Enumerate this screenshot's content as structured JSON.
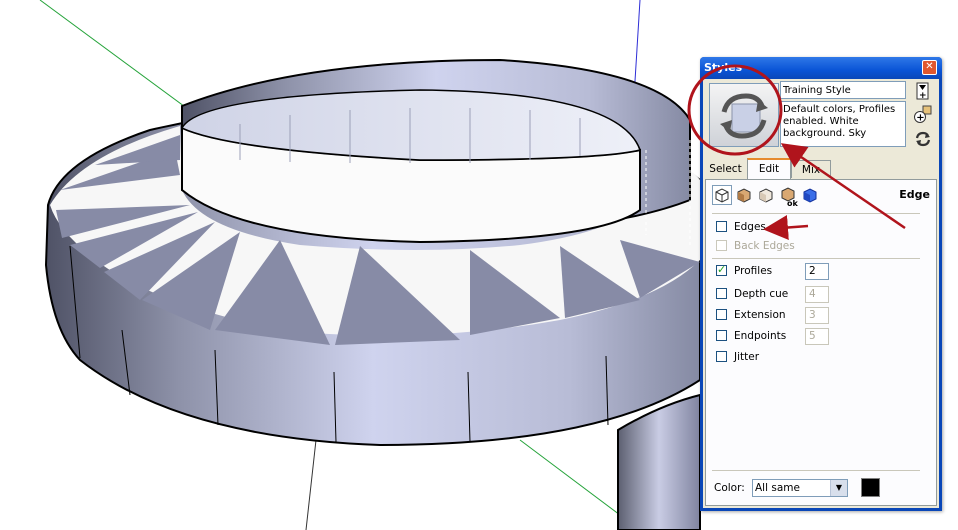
{
  "panel": {
    "title": "Styles",
    "close_glyph": "✕",
    "style_name": "Training Style",
    "style_description": "Default colors, Profiles enabled. White background. Sky",
    "side_buttons": [
      "create-style-icon",
      "add-icon",
      "refresh-icon"
    ],
    "tabs": [
      {
        "label": "Select",
        "active": false
      },
      {
        "label": "Edit",
        "active": true
      },
      {
        "label": "Mix",
        "active": false
      }
    ],
    "edit_section_title": "Edge",
    "edge_settings": [
      {
        "label": "Edges",
        "checked": false,
        "enabled": true,
        "value": null
      },
      {
        "label": "Back Edges",
        "checked": false,
        "enabled": false,
        "value": null
      },
      {
        "label": "Profiles",
        "checked": true,
        "enabled": true,
        "value": "2"
      },
      {
        "label": "Depth cue",
        "checked": false,
        "enabled": true,
        "value": "4"
      },
      {
        "label": "Extension",
        "checked": false,
        "enabled": true,
        "value": "3"
      },
      {
        "label": "Endpoints",
        "checked": false,
        "enabled": true,
        "value": "5"
      },
      {
        "label": "Jitter",
        "checked": false,
        "enabled": true,
        "value": null
      }
    ],
    "color_label": "Color:",
    "color_value": "All same",
    "swatch_color": "#000000"
  },
  "colors": {
    "annotation_red": "#b0141c",
    "model_face": "#c3c7e3",
    "model_top": "#f7f7f7"
  }
}
